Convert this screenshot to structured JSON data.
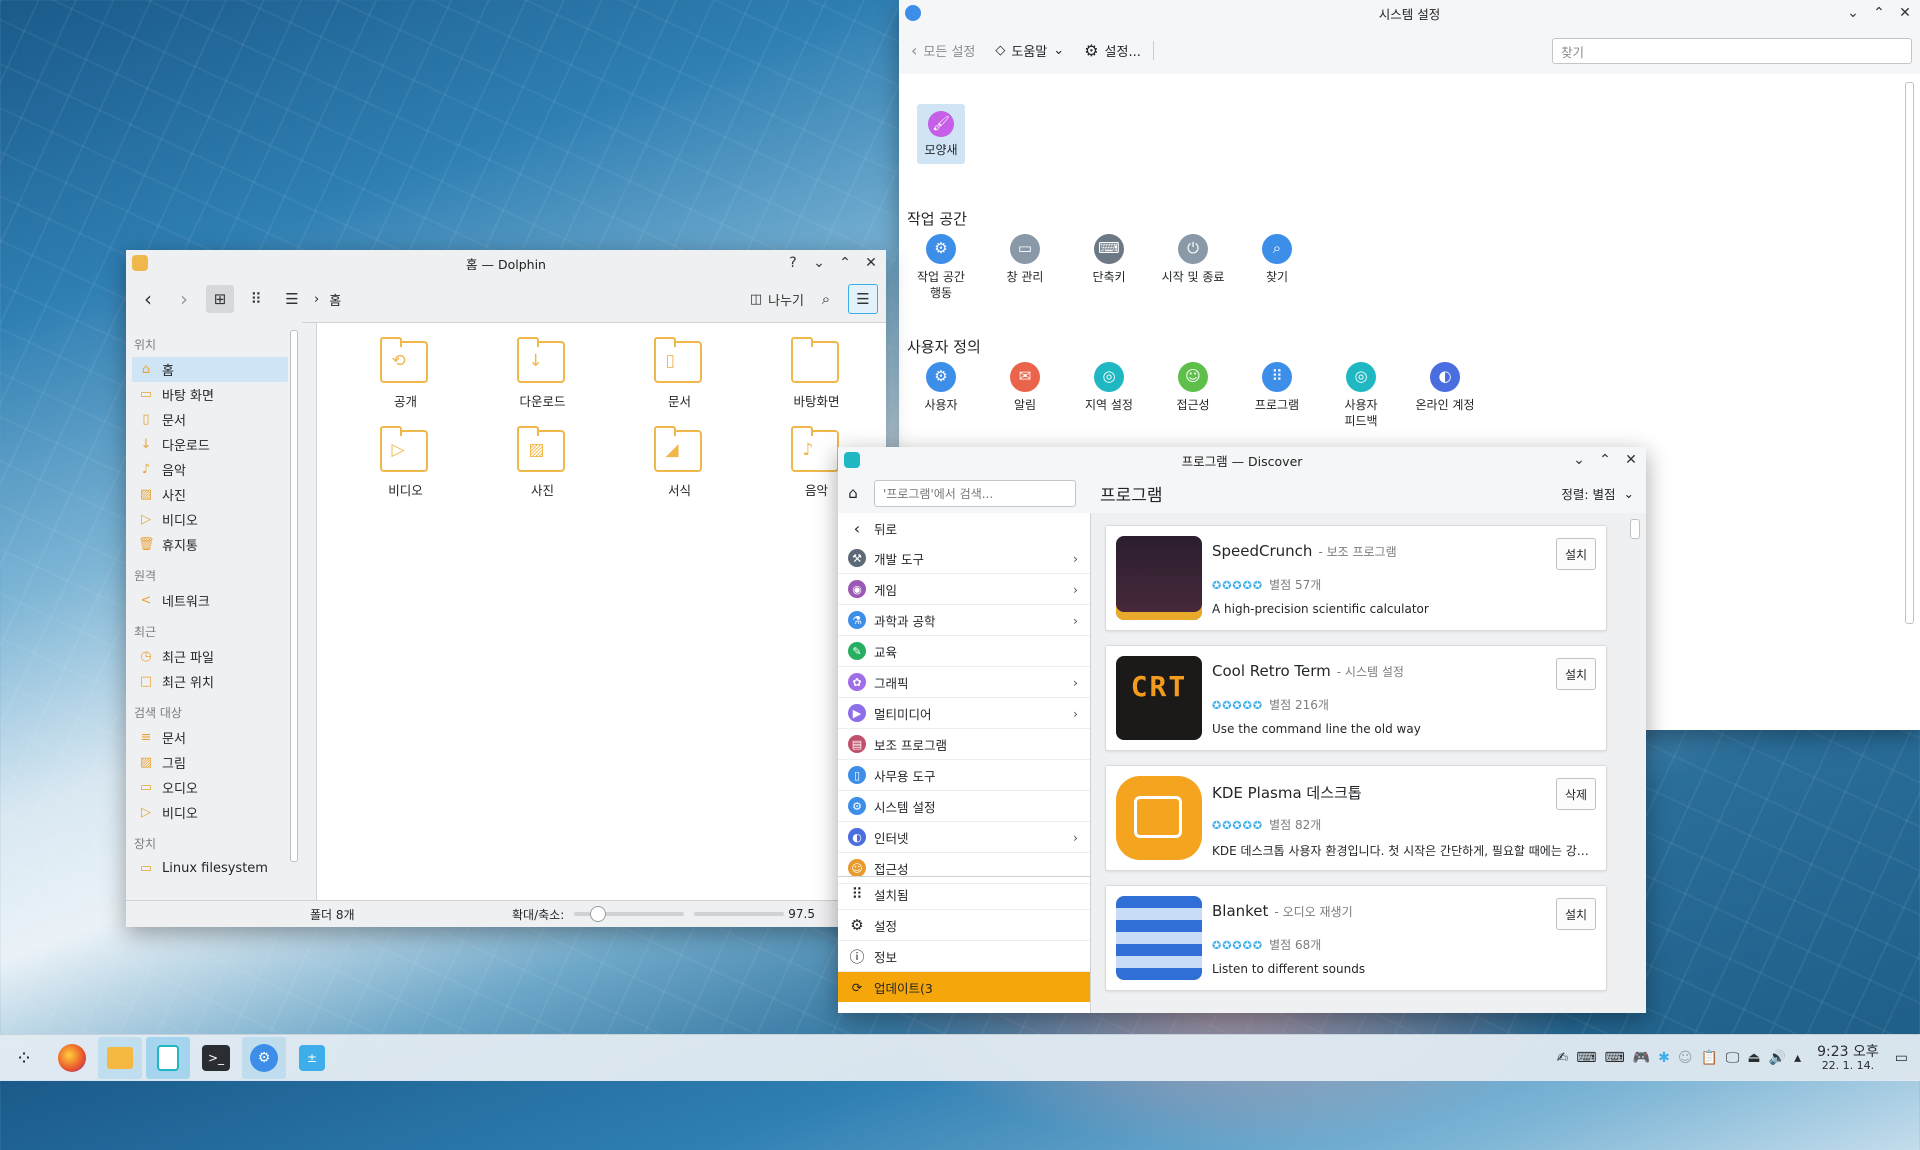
{
  "dolphin": {
    "title": "홈 — Dolphin",
    "breadcrumb": "홈",
    "split_label": "나누기",
    "places": [
      {
        "section": "위치",
        "items": [
          {
            "label": "홈",
            "icon": "home-icon",
            "selected": true
          },
          {
            "label": "바탕 화면",
            "icon": "desktop-icon"
          },
          {
            "label": "문서",
            "icon": "document-icon"
          },
          {
            "label": "다운로드",
            "icon": "download-icon"
          },
          {
            "label": "음악",
            "icon": "music-icon"
          },
          {
            "label": "사진",
            "icon": "picture-icon"
          },
          {
            "label": "비디오",
            "icon": "video-icon"
          },
          {
            "label": "휴지통",
            "icon": "trash-icon"
          }
        ]
      },
      {
        "section": "원격",
        "items": [
          {
            "label": "네트워크",
            "icon": "network-icon"
          }
        ]
      },
      {
        "section": "최근",
        "items": [
          {
            "label": "최근 파일",
            "icon": "recent-files-icon"
          },
          {
            "label": "최근 위치",
            "icon": "recent-locations-icon"
          }
        ]
      },
      {
        "section": "검색 대상",
        "items": [
          {
            "label": "문서",
            "icon": "document-search-icon"
          },
          {
            "label": "그림",
            "icon": "image-search-icon"
          },
          {
            "label": "오디오",
            "icon": "audio-search-icon"
          },
          {
            "label": "비디오",
            "icon": "video-search-icon"
          }
        ]
      },
      {
        "section": "장치",
        "items": [
          {
            "label": "Linux filesystem",
            "icon": "drive-icon"
          }
        ]
      }
    ],
    "files": [
      {
        "label": "공개",
        "icon": "folder-public-icon"
      },
      {
        "label": "다운로드",
        "icon": "folder-download-icon"
      },
      {
        "label": "문서",
        "icon": "folder-documents-icon"
      },
      {
        "label": "바탕화면",
        "icon": "folder-desktop-icon"
      },
      {
        "label": "비디오",
        "icon": "folder-videos-icon"
      },
      {
        "label": "사진",
        "icon": "folder-pictures-icon"
      },
      {
        "label": "서식",
        "icon": "folder-templates-icon"
      },
      {
        "label": "음악",
        "icon": "folder-music-icon"
      }
    ],
    "status": {
      "folder_count": "폴더 8개",
      "zoom_label": "확대/축소:",
      "free_space": "97.5"
    }
  },
  "settings": {
    "title": "시스템 설정",
    "back_label": "모든 설정",
    "help_label": "도움말",
    "configure_label": "설정...",
    "search_placeholder": "찾기",
    "top_item": {
      "label": "모양새",
      "icon": "appearance-icon"
    },
    "sections": [
      {
        "title": "작업 공간",
        "items": [
          {
            "label": "작업 공간\n행동",
            "icon": "workspace-behavior-icon",
            "color": "#3d8ee9"
          },
          {
            "label": "창 관리",
            "icon": "window-management-icon",
            "color": "#8a99a8"
          },
          {
            "label": "단축키",
            "icon": "shortcuts-icon",
            "color": "#6c7884"
          },
          {
            "label": "시작 및 종료",
            "icon": "startup-shutdown-icon",
            "color": "#8a99a8"
          },
          {
            "label": "찾기",
            "icon": "search-icon",
            "color": "#3d8ee9"
          }
        ]
      },
      {
        "title": "사용자 정의",
        "items": [
          {
            "label": "사용자",
            "icon": "users-icon",
            "color": "#3d8ee9"
          },
          {
            "label": "알림",
            "icon": "notifications-icon",
            "color": "#e9644a"
          },
          {
            "label": "지역 설정",
            "icon": "regional-settings-icon",
            "color": "#1fb8c2"
          },
          {
            "label": "접근성",
            "icon": "accessibility-icon",
            "color": "#5ec04a"
          },
          {
            "label": "프로그램",
            "icon": "applications-icon",
            "color": "#3d8ee9"
          },
          {
            "label": "사용자\n피드백",
            "icon": "feedback-icon",
            "color": "#1fb8c2"
          },
          {
            "label": "온라인 계정",
            "icon": "online-accounts-icon",
            "color": "#4a6ee0"
          }
        ]
      }
    ]
  },
  "discover": {
    "title": "프로그램 — Discover",
    "search_placeholder": "'프로그램'에서 검색...",
    "page_title": "프로그램",
    "sort_label": "정렬: 별점",
    "back_label": "뒤로",
    "categories": [
      {
        "label": "개발 도구",
        "icon": "developer-tools-icon",
        "color": "#5c6a77",
        "chevron": true
      },
      {
        "label": "게임",
        "icon": "games-icon",
        "color": "#9b59b6",
        "chevron": true
      },
      {
        "label": "과학과 공학",
        "icon": "science-icon",
        "color": "#3d8ee9",
        "chevron": true
      },
      {
        "label": "교육",
        "icon": "education-icon",
        "color": "#27ae60",
        "chevron": false
      },
      {
        "label": "그래픽",
        "icon": "graphics-icon",
        "color": "#a06ee8",
        "chevron": true
      },
      {
        "label": "멀티미디어",
        "icon": "multimedia-icon",
        "color": "#8e6ee8",
        "chevron": true
      },
      {
        "label": "보조 프로그램",
        "icon": "accessories-icon",
        "color": "#c0506a",
        "chevron": false
      },
      {
        "label": "사무용 도구",
        "icon": "office-icon",
        "color": "#3d8ee9",
        "chevron": false
      },
      {
        "label": "시스템 설정",
        "icon": "system-settings-icon",
        "color": "#3d8ee9",
        "chevron": false
      },
      {
        "label": "인터넷",
        "icon": "internet-icon",
        "color": "#4a6ee0",
        "chevron": true
      },
      {
        "label": "접근성",
        "icon": "accessibility-icon",
        "color": "#e89a2c",
        "chevron": false
      }
    ],
    "bottom_items": [
      {
        "label": "설치됨",
        "icon": "installed-icon"
      },
      {
        "label": "설정",
        "icon": "settings-gear-icon"
      },
      {
        "label": "정보",
        "icon": "info-icon"
      }
    ],
    "updates_label": "업데이트(3",
    "apps": [
      {
        "name": "SpeedCrunch",
        "category": "- 보조 프로그램",
        "rating": "별점 57개",
        "description": "A high-precision scientific calculator",
        "action": "설치"
      },
      {
        "name": "Cool Retro Term",
        "category": "- 시스템 설정",
        "rating": "별점 216개",
        "description": "Use the command line the old way",
        "action": "설치"
      },
      {
        "name": "KDE Plasma 데스크톱",
        "category": "",
        "rating": "별점 82개",
        "description": "KDE 데스크톱 사용자 환경입니다. 첫 시작은 간단하게, 필요할 때에는 강력하게",
        "action": "삭제"
      },
      {
        "name": "Blanket",
        "category": "- 오디오 재생기",
        "rating": "별점 68개",
        "description": "Listen to different sounds",
        "action": "설치"
      }
    ],
    "crt_label": "CRT"
  },
  "taskbar": {
    "clock_time": "9:23 오후",
    "clock_date": "22. 1. 14."
  }
}
